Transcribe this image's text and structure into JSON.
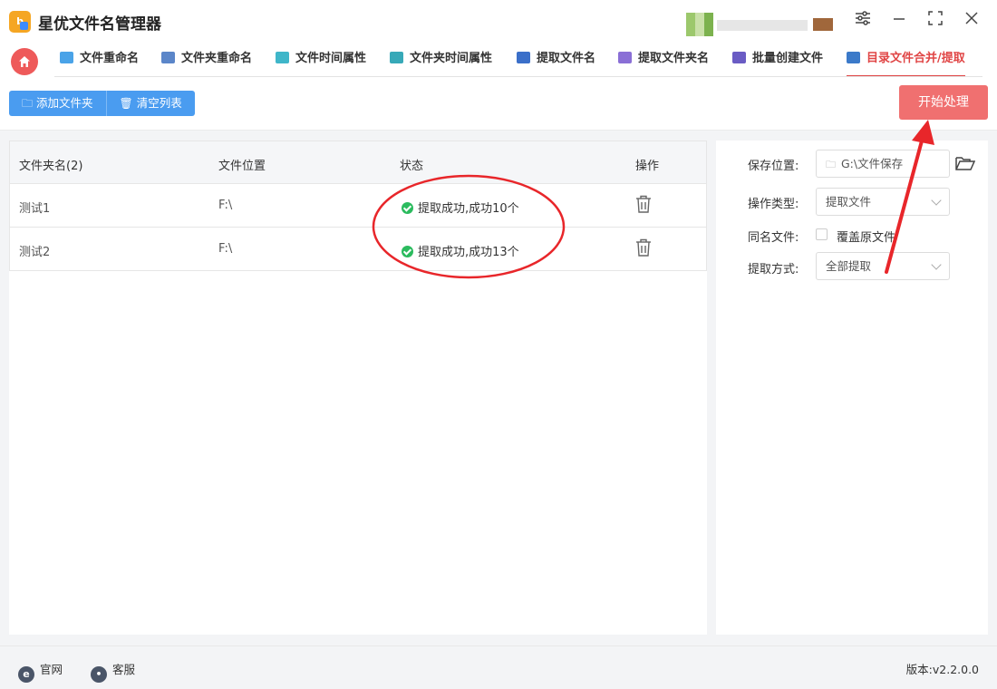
{
  "app": {
    "logo_text": "b",
    "title": "星优文件名管理器"
  },
  "window_controls": {
    "settings_icon": "sliders-icon",
    "minimize_icon": "minimize-icon",
    "maximize_icon": "maximize-icon",
    "close_icon": "close-icon"
  },
  "tabs": [
    {
      "label": "文件重命名",
      "icon": "file-rename-icon",
      "color": "#4aa3e8"
    },
    {
      "label": "文件夹重命名",
      "icon": "folder-rename-icon",
      "color": "#5b86c9"
    },
    {
      "label": "文件时间属性",
      "icon": "file-time-icon",
      "color": "#3fb6c9"
    },
    {
      "label": "文件夹时间属性",
      "icon": "folder-time-icon",
      "color": "#37a9b8"
    },
    {
      "label": "提取文件名",
      "icon": "extract-filename-icon",
      "color": "#3b6fc9"
    },
    {
      "label": "提取文件夹名",
      "icon": "extract-foldername-icon",
      "color": "#8a6fd6"
    },
    {
      "label": "批量创建文件",
      "icon": "batch-create-icon",
      "color": "#6a5cc4"
    },
    {
      "label": "目录文件合并/提取",
      "icon": "merge-extract-icon",
      "color": "#3b7ac9",
      "active": true
    }
  ],
  "toolbar": {
    "add_folder": "添加文件夹",
    "clear_list": "清空列表",
    "start": "开始处理"
  },
  "table": {
    "headers": {
      "name": "文件夹名(2)",
      "location": "文件位置",
      "status": "状态",
      "action": "操作"
    },
    "rows": [
      {
        "name": "测试1",
        "location": "F:\\",
        "status": "提取成功,成功10个"
      },
      {
        "name": "测试2",
        "location": "F:\\",
        "status": "提取成功,成功13个"
      }
    ]
  },
  "settings": {
    "save_location_label": "保存位置:",
    "save_location_value": "G:\\文件保存",
    "operation_type_label": "操作类型:",
    "operation_type_value": "提取文件",
    "same_name_label": "同名文件:",
    "overwrite_label": "覆盖原文件",
    "extract_mode_label": "提取方式:",
    "extract_mode_value": "全部提取"
  },
  "footer": {
    "website": "官网",
    "support": "客服",
    "version": "版本:v2.2.0.0"
  },
  "colors": {
    "accent_red": "#e04545",
    "primary_blue": "#4a9cf0",
    "start_button": "#f07070",
    "success_green": "#2bbb5e",
    "annotation_red": "#e8262a"
  }
}
